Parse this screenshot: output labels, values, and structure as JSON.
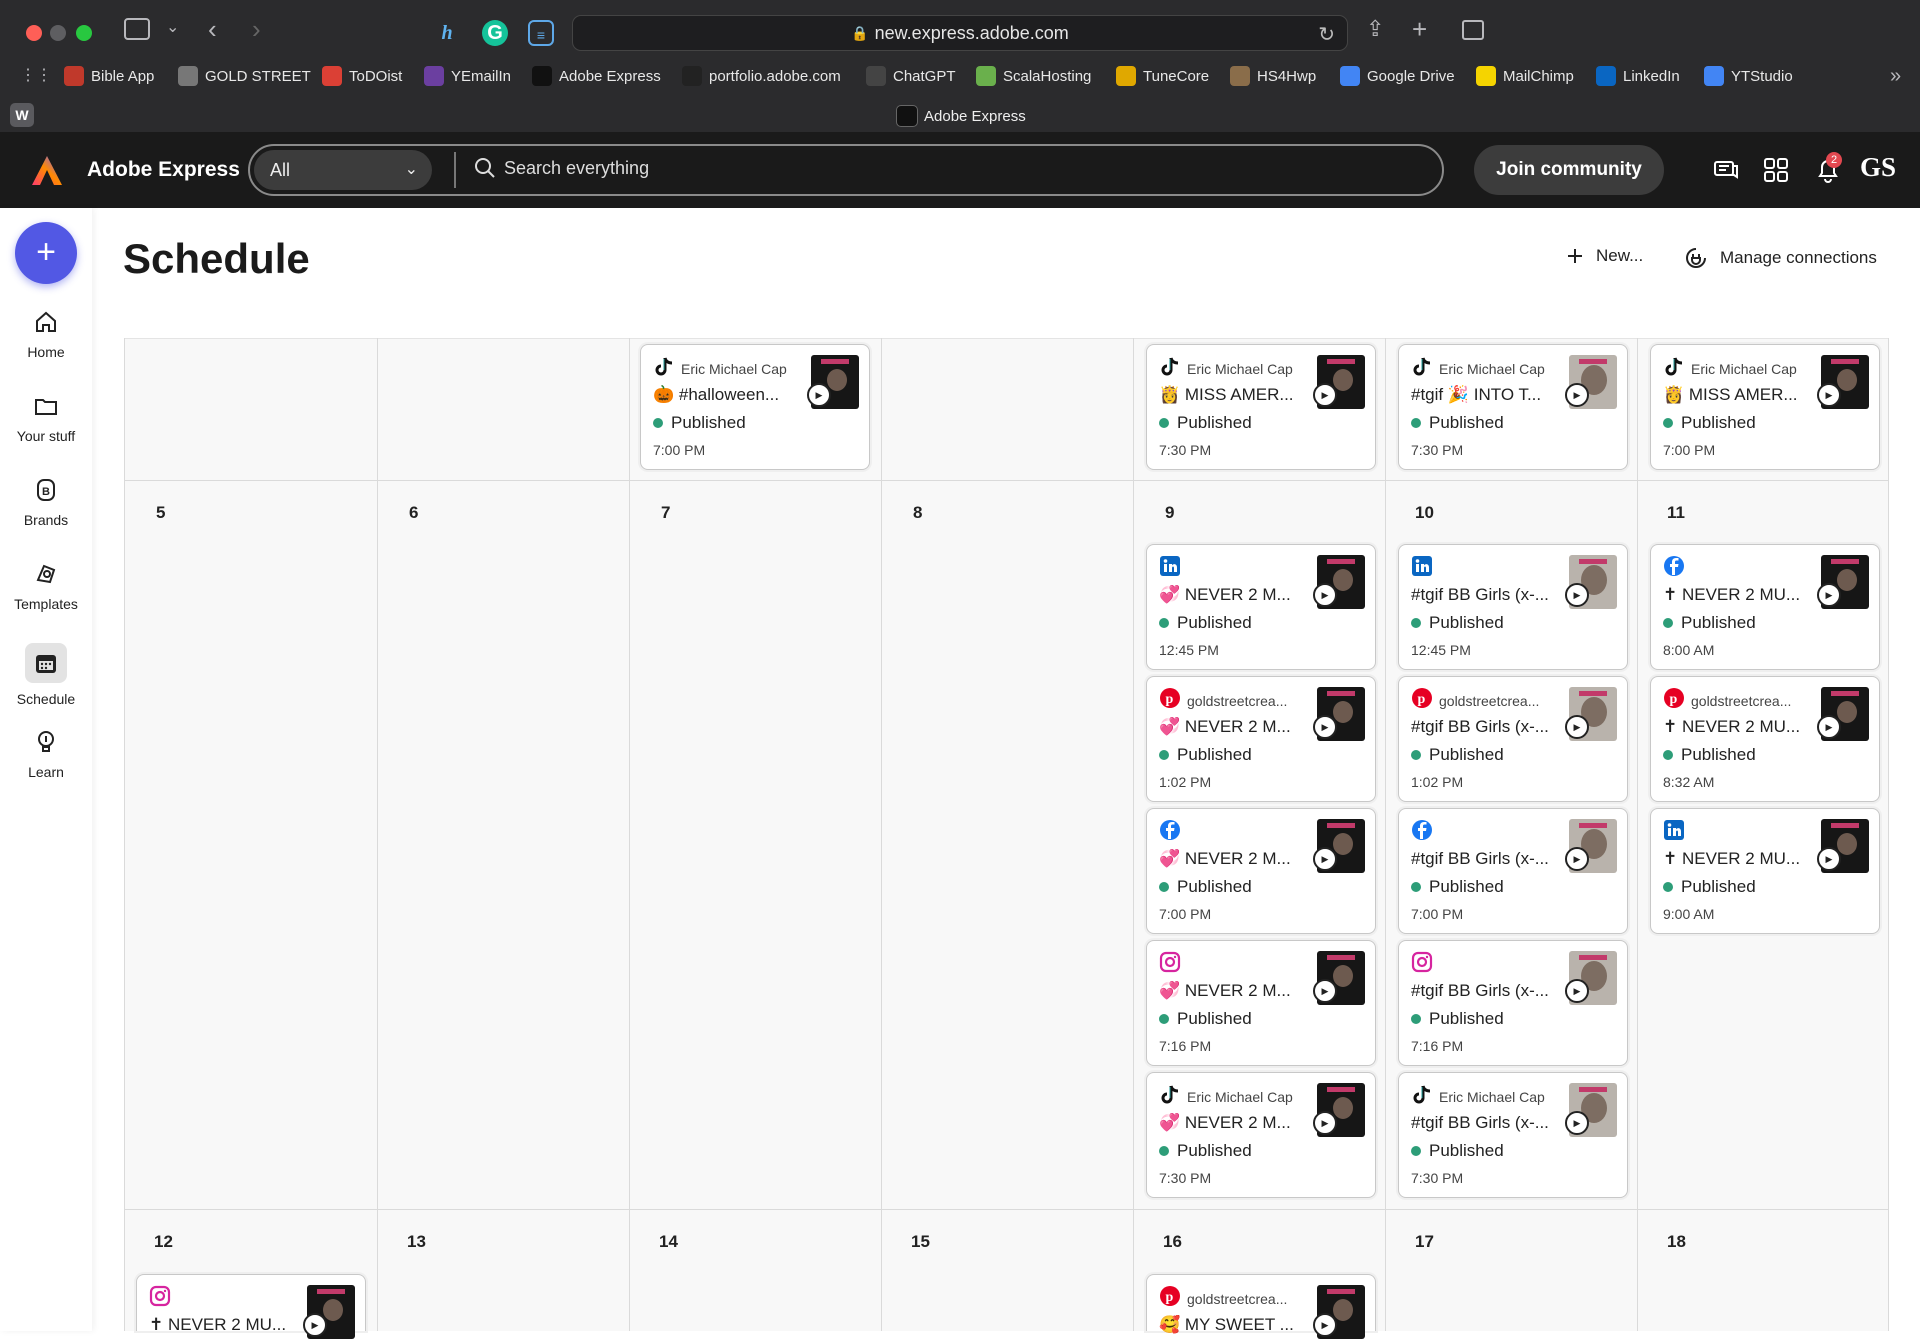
{
  "browser": {
    "url": "new.express.adobe.com",
    "tab_title": "Adobe Express",
    "workspace_letter": "W",
    "bookmarks": [
      {
        "label": "Bible App",
        "color": "#c0392b"
      },
      {
        "label": "GOLD STREET",
        "color": "#777"
      },
      {
        "label": "ToDOist",
        "color": "#db4035"
      },
      {
        "label": "YEmailIn",
        "color": "#6b3fa0"
      },
      {
        "label": "Adobe Express",
        "color": "#111"
      },
      {
        "label": "portfolio.adobe.com",
        "color": "#222"
      },
      {
        "label": "ChatGPT",
        "color": "#444"
      },
      {
        "label": "ScalaHosting",
        "color": "#6ab04c"
      },
      {
        "label": "TuneCore",
        "color": "#e0a800"
      },
      {
        "label": "HS4Hwp",
        "color": "#8a6d4a"
      },
      {
        "label": "Google Drive",
        "color": "#4285f4"
      },
      {
        "label": "MailChimp",
        "color": "#f5d400"
      },
      {
        "label": "LinkedIn",
        "color": "#0a66c2"
      },
      {
        "label": "YTStudio",
        "color": "#4285f4"
      }
    ]
  },
  "app": {
    "name": "Adobe Express",
    "search_filter": "All",
    "search_placeholder": "Search everything",
    "join_label": "Join community",
    "notification_count": "2",
    "user_initials": "GS"
  },
  "sidebar": {
    "items": [
      {
        "label": "Home",
        "icon": "home-icon"
      },
      {
        "label": "Your stuff",
        "icon": "folder-icon"
      },
      {
        "label": "Brands",
        "icon": "brand-icon"
      },
      {
        "label": "Templates",
        "icon": "templates-icon"
      },
      {
        "label": "Schedule",
        "icon": "calendar-icon"
      },
      {
        "label": "Learn",
        "icon": "lightbulb-icon"
      }
    ]
  },
  "page": {
    "title": "Schedule",
    "new_label": "New...",
    "manage_label": "Manage connections"
  },
  "calendar": {
    "day_numbers": [
      "5",
      "6",
      "7",
      "8",
      "9",
      "10",
      "11",
      "12",
      "13",
      "14",
      "15",
      "16",
      "17",
      "18"
    ],
    "cards": [
      {
        "platform": "tiktok",
        "account": "Eric Michael Cap",
        "title": "🎃 #halloween...",
        "status": "Published",
        "time": "7:00 PM"
      },
      {
        "platform": "tiktok",
        "account": "Eric Michael Cap",
        "title": "👸 MISS AMER...",
        "status": "Published",
        "time": "7:30 PM"
      },
      {
        "platform": "tiktok",
        "account": "Eric Michael Cap",
        "title": "#tgif 🎉 INTO T...",
        "status": "Published",
        "time": "7:30 PM"
      },
      {
        "platform": "tiktok",
        "account": "Eric Michael Cap",
        "title": "👸 MISS AMER...",
        "status": "Published",
        "time": "7:00 PM"
      },
      {
        "platform": "linkedin",
        "account": "",
        "title": "💞 NEVER 2 M...",
        "status": "Published",
        "time": "12:45 PM"
      },
      {
        "platform": "pinterest",
        "account": "goldstreetcrea...",
        "title": "💞 NEVER 2 M...",
        "status": "Published",
        "time": "1:02 PM"
      },
      {
        "platform": "facebook",
        "account": "",
        "title": "💞 NEVER 2 M...",
        "status": "Published",
        "time": "7:00 PM"
      },
      {
        "platform": "instagram",
        "account": "",
        "title": "💞 NEVER 2 M...",
        "status": "Published",
        "time": "7:16 PM"
      },
      {
        "platform": "tiktok",
        "account": "Eric Michael Cap",
        "title": "💞 NEVER 2 M...",
        "status": "Published",
        "time": "7:30 PM"
      },
      {
        "platform": "linkedin",
        "account": "",
        "title": "#tgif BB Girls (x-...",
        "status": "Published",
        "time": "12:45 PM"
      },
      {
        "platform": "pinterest",
        "account": "goldstreetcrea...",
        "title": "#tgif BB Girls (x-...",
        "status": "Published",
        "time": "1:02 PM"
      },
      {
        "platform": "facebook",
        "account": "",
        "title": "#tgif BB Girls (x-...",
        "status": "Published",
        "time": "7:00 PM"
      },
      {
        "platform": "instagram",
        "account": "",
        "title": "#tgif BB Girls (x-...",
        "status": "Published",
        "time": "7:16 PM"
      },
      {
        "platform": "tiktok",
        "account": "Eric Michael Cap",
        "title": "#tgif BB Girls (x-...",
        "status": "Published",
        "time": "7:30 PM"
      },
      {
        "platform": "facebook",
        "account": "",
        "title": "✝ NEVER 2 MU...",
        "status": "Published",
        "time": "8:00 AM"
      },
      {
        "platform": "pinterest",
        "account": "goldstreetcrea...",
        "title": "✝ NEVER 2 MU...",
        "status": "Published",
        "time": "8:32 AM"
      },
      {
        "platform": "linkedin",
        "account": "",
        "title": "✝ NEVER 2 MU...",
        "status": "Published",
        "time": "9:00 AM"
      },
      {
        "platform": "instagram",
        "account": "",
        "title": "✝ NEVER 2 MU...",
        "status": "",
        "time": ""
      },
      {
        "platform": "pinterest",
        "account": "goldstreetcrea...",
        "title": "🥰 MY SWEET ...",
        "status": "",
        "time": ""
      }
    ]
  },
  "colors": {
    "accent": "#5258e4",
    "published": "#2d9d78",
    "tiktok": "#111111",
    "linkedin": "#0a66c2",
    "pinterest": "#e60023",
    "facebook": "#1877f2",
    "instagram": "#d6249f"
  }
}
